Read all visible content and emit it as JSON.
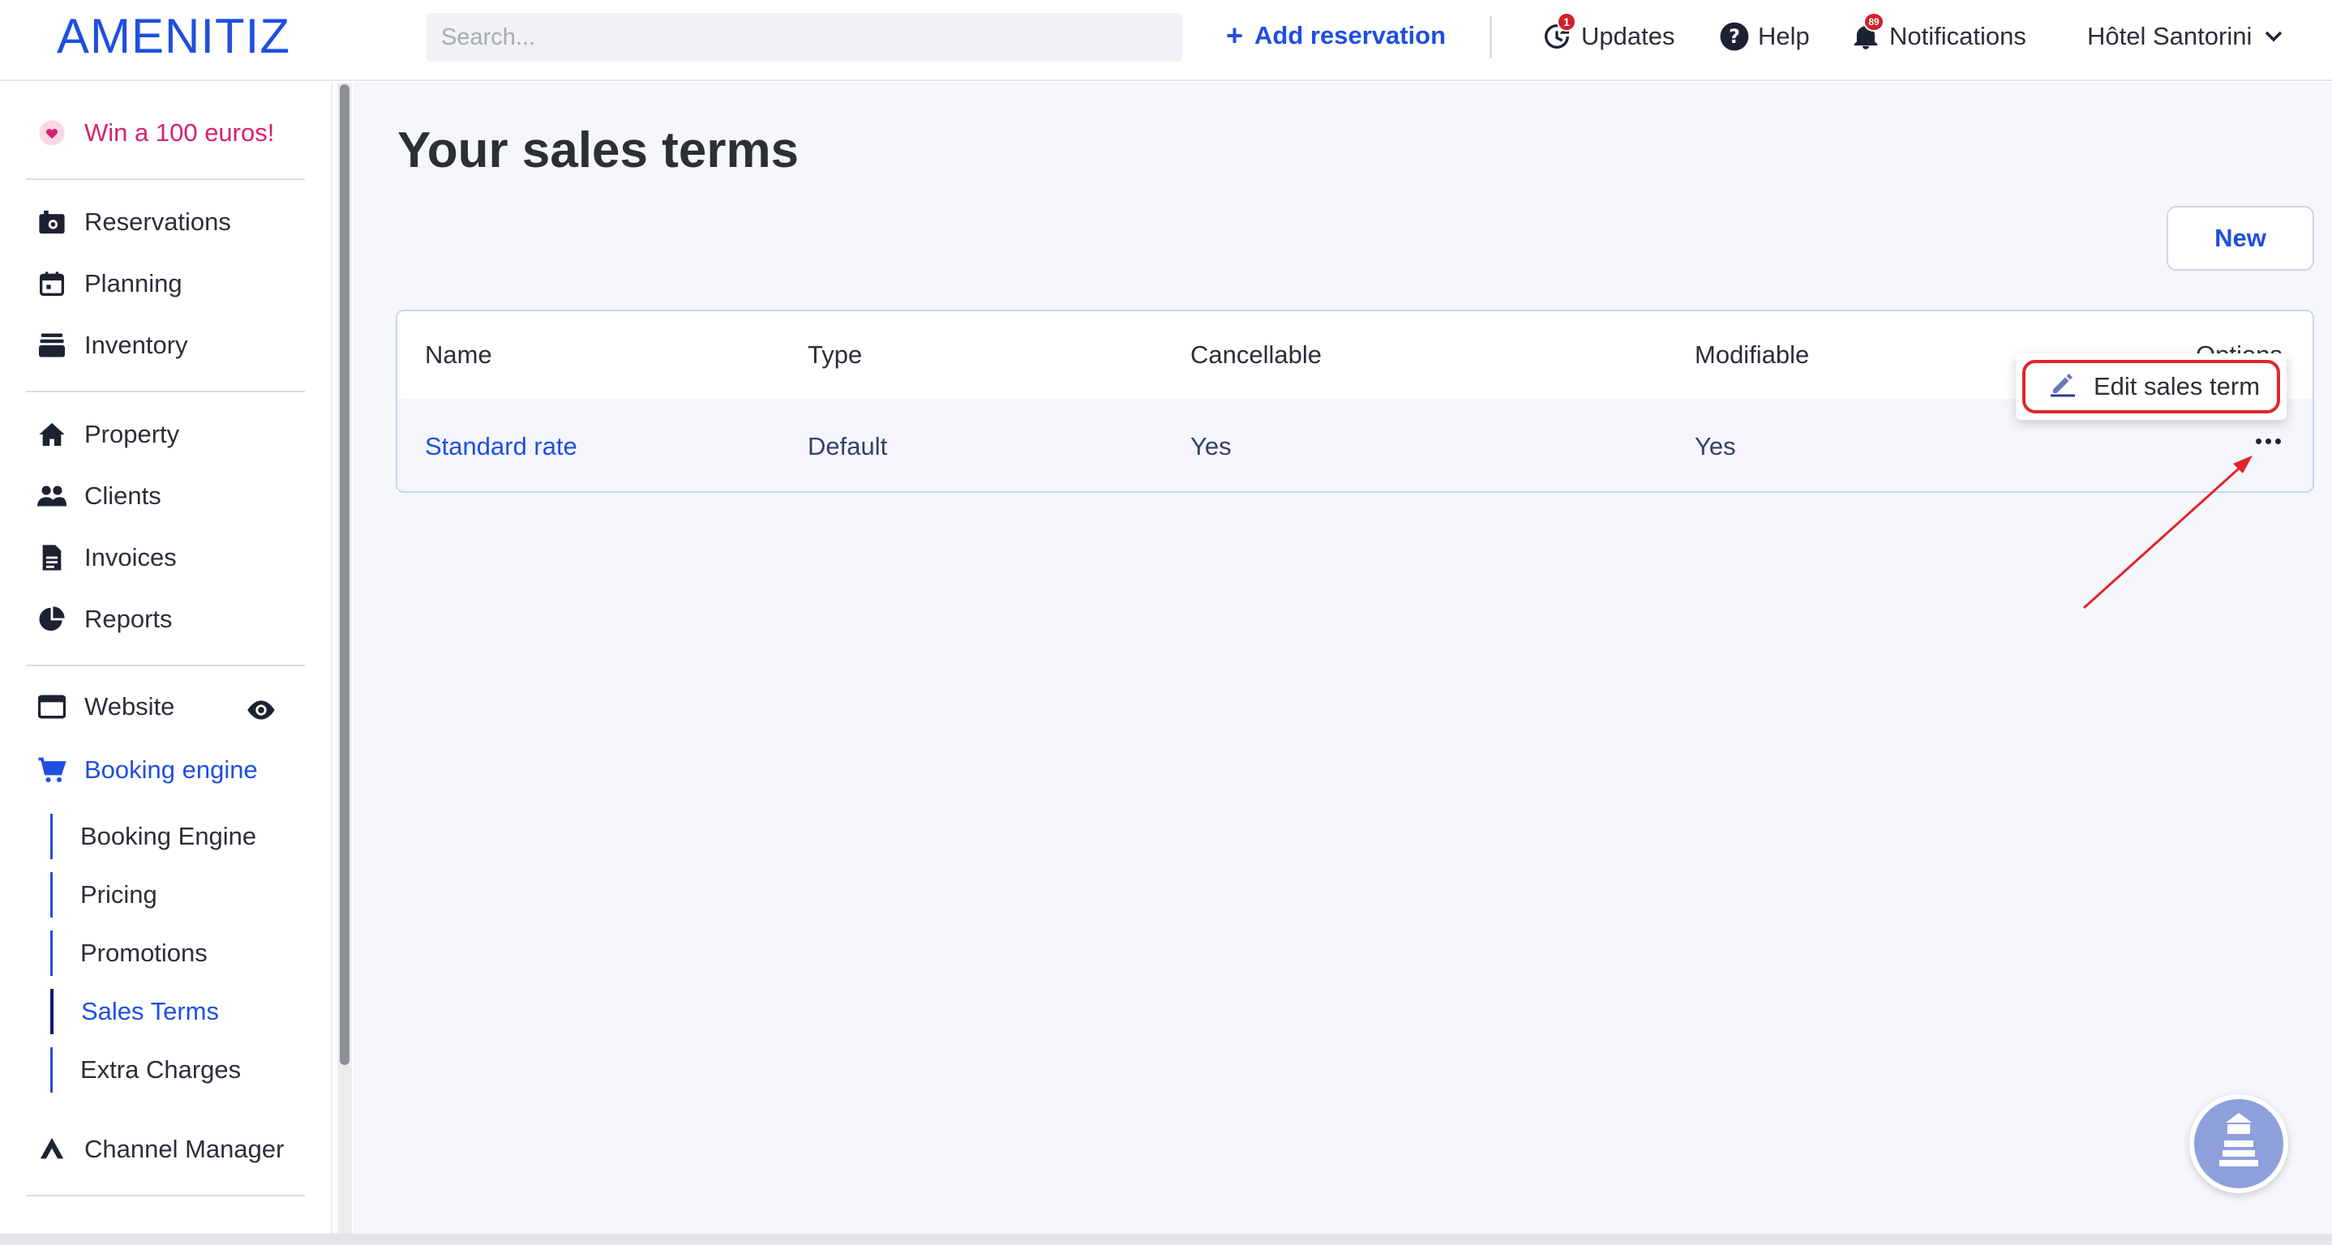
{
  "app": {
    "logo": "AMENITIZ"
  },
  "topbar": {
    "search_placeholder": "Search...",
    "add_reservation": "Add reservation",
    "updates": {
      "label": "Updates",
      "count": "1"
    },
    "help": "Help",
    "notifications": {
      "label": "Notifications",
      "count": "89"
    },
    "hotel": "Hôtel Santorini"
  },
  "sidebar": {
    "promo": "Win a 100 euros!",
    "items": [
      {
        "label": "Reservations",
        "icon": "reservations-icon"
      },
      {
        "label": "Planning",
        "icon": "calendar-icon"
      },
      {
        "label": "Inventory",
        "icon": "inventory-icon"
      },
      {
        "label": "Property",
        "icon": "home-icon"
      },
      {
        "label": "Clients",
        "icon": "clients-icon"
      },
      {
        "label": "Invoices",
        "icon": "invoice-icon"
      },
      {
        "label": "Reports",
        "icon": "pie-chart-icon"
      },
      {
        "label": "Website",
        "icon": "browser-icon"
      },
      {
        "label": "Booking engine",
        "icon": "cart-icon"
      },
      {
        "label": "Channel Manager",
        "icon": "channel-icon"
      }
    ],
    "booking_subitems": [
      "Booking Engine",
      "Pricing",
      "Promotions",
      "Sales Terms",
      "Extra Charges"
    ],
    "active_subitem": "Sales Terms"
  },
  "main": {
    "title": "Your sales terms",
    "new_button": "New",
    "table": {
      "headers": [
        "Name",
        "Type",
        "Cancellable",
        "Modifiable",
        "Options"
      ],
      "rows": [
        {
          "name": "Standard rate",
          "type": "Default",
          "cancellable": "Yes",
          "modifiable": "Yes"
        }
      ]
    },
    "options_menu": {
      "edit": "Edit sales term"
    }
  },
  "colors": {
    "brand": "#1f4fe0",
    "promo": "#d6226e",
    "annotation": "#e0262b",
    "badge": "#d0202a"
  }
}
